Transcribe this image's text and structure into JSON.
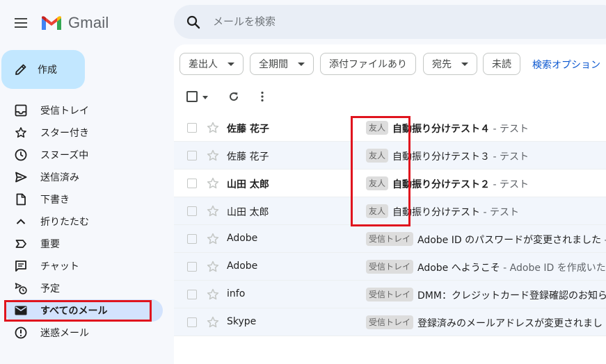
{
  "app": {
    "name": "Gmail"
  },
  "search": {
    "placeholder": "メールを検索"
  },
  "compose": {
    "label": "作成"
  },
  "sidebar": {
    "items": [
      {
        "label": "受信トレイ",
        "icon": "inbox-icon"
      },
      {
        "label": "スター付き",
        "icon": "star-icon"
      },
      {
        "label": "スヌーズ中",
        "icon": "clock-icon"
      },
      {
        "label": "送信済み",
        "icon": "send-icon"
      },
      {
        "label": "下書き",
        "icon": "draft-icon"
      },
      {
        "label": "折りたたむ",
        "icon": "chevron-up-icon"
      },
      {
        "label": "重要",
        "icon": "important-icon"
      },
      {
        "label": "チャット",
        "icon": "chat-icon"
      },
      {
        "label": "予定",
        "icon": "scheduled-icon"
      },
      {
        "label": "すべてのメール",
        "icon": "mail-icon",
        "active": true
      },
      {
        "label": "迷惑メール",
        "icon": "spam-icon"
      }
    ]
  },
  "filters": {
    "sender": "差出人",
    "period": "全期間",
    "attachment": "添付ファイルあり",
    "to": "宛先",
    "unread": "未読",
    "search_options": "検索オプション"
  },
  "emails": [
    {
      "sender": "佐藤 花子",
      "label": "友人",
      "subject": "自動振り分けテスト４",
      "snippet": " - テスト",
      "unread": true
    },
    {
      "sender": "佐藤 花子",
      "label": "友人",
      "subject": "自動振り分けテスト３",
      "snippet": " - テスト",
      "unread": false
    },
    {
      "sender": "山田 太郎",
      "label": "友人",
      "subject": "自動振り分けテスト２",
      "snippet": " - テスト",
      "unread": true
    },
    {
      "sender": "山田 太郎",
      "label": "友人",
      "subject": "自動振り分けテスト",
      "snippet": " - テスト",
      "unread": false
    },
    {
      "sender": "Adobe",
      "label": "受信トレイ",
      "subject": "Adobe ID のパスワードが変更されました",
      "snippet": " - ",
      "unread": false
    },
    {
      "sender": "Adobe",
      "label": "受信トレイ",
      "subject": "Adobe へようこそ",
      "snippet": " - Adobe ID を作成いただ",
      "unread": false
    },
    {
      "sender": "info",
      "label": "受信トレイ",
      "subject": "DMM：クレジットカード登録確認のお知ら",
      "snippet": "",
      "unread": false
    },
    {
      "sender": "Skype",
      "label": "受信トレイ",
      "subject": "登録済みのメールアドレスが変更されまし",
      "snippet": "",
      "unread": false
    }
  ],
  "colors": {
    "accent": "#0b57d0",
    "compose_bg": "#c2e7ff",
    "active_nav": "#d3e3fd",
    "highlight": "#e0141e"
  }
}
